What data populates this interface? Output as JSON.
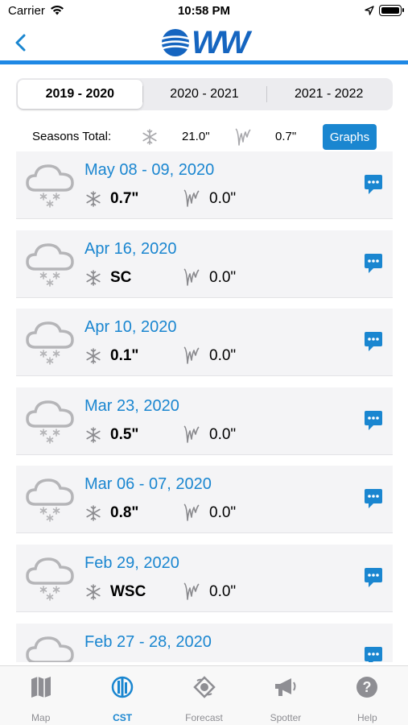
{
  "status_bar": {
    "carrier": "Carrier",
    "time": "10:58 PM"
  },
  "nav": {
    "logo_text": "WW"
  },
  "seasons": [
    {
      "label": "2019 - 2020",
      "active": true
    },
    {
      "label": "2020 - 2021",
      "active": false
    },
    {
      "label": "2021 - 2022",
      "active": false
    }
  ],
  "totals": {
    "label": "Seasons Total:",
    "snow": "21.0\"",
    "ice": "0.7\"",
    "graphs_label": "Graphs"
  },
  "events": [
    {
      "date": "May 08 - 09, 2020",
      "snow": "0.7\"",
      "ice": "0.0\""
    },
    {
      "date": "Apr 16, 2020",
      "snow": "SC",
      "ice": "0.0\""
    },
    {
      "date": "Apr 10, 2020",
      "snow": "0.1\"",
      "ice": "0.0\""
    },
    {
      "date": "Mar 23, 2020",
      "snow": "0.5\"",
      "ice": "0.0\""
    },
    {
      "date": "Mar 06 - 07, 2020",
      "snow": "0.8\"",
      "ice": "0.0\""
    },
    {
      "date": "Feb 29, 2020",
      "snow": "WSC",
      "ice": "0.0\""
    },
    {
      "date": "Feb 27 - 28, 2020",
      "snow": "",
      "ice": ""
    }
  ],
  "tabs": [
    {
      "label": "Map",
      "icon": "map-icon",
      "active": false
    },
    {
      "label": "CST",
      "icon": "cst-icon",
      "active": true
    },
    {
      "label": "Forecast",
      "icon": "forecast-icon",
      "active": false
    },
    {
      "label": "Spotter",
      "icon": "megaphone-icon",
      "active": false
    },
    {
      "label": "Help",
      "icon": "help-icon",
      "active": false
    }
  ],
  "colors": {
    "accent": "#1a86d0",
    "nav_border": "#1e88e5",
    "row_bg": "#f4f4f6",
    "icon_gray": "#b5b5b8"
  }
}
